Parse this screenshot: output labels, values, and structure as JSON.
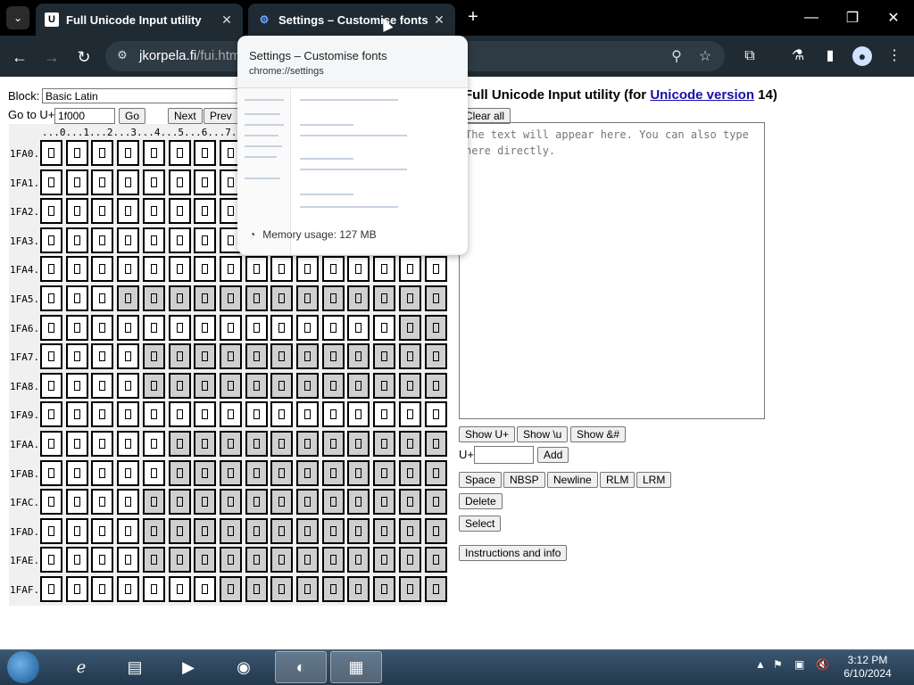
{
  "browser": {
    "tabs": [
      {
        "title": "Full Unicode Input utility",
        "favicon": "U",
        "active": true
      },
      {
        "title": "Settings – Customise fonts",
        "favicon": "⚙",
        "active": false
      }
    ],
    "url_host": "jkorpela.fi",
    "url_path": "/fui.html"
  },
  "preview": {
    "title": "Settings – Customise fonts",
    "url": "chrome://settings",
    "memory": "Memory usage: 127 MB"
  },
  "left": {
    "block_label": "Block:",
    "block_value": "Basic Latin",
    "goto_label": "Go to U+",
    "goto_value": "1f000",
    "go_button": "Go",
    "next_button": "Next",
    "prev_button": "Prev",
    "column_header": "...0...1...2...3...4...5...6...7...8...9...A...B...C...D...E...F",
    "row_labels": [
      "1FA0.",
      "1FA1.",
      "1FA2.",
      "1FA3.",
      "1FA4.",
      "1FA5.",
      "1FA6.",
      "1FA7.",
      "1FA8.",
      "1FA9.",
      "1FAA.",
      "1FAB.",
      "1FAC.",
      "1FAD.",
      "1FAE.",
      "1FAF."
    ],
    "unassigned_map": [
      "0000000000000000",
      "0000000000000000",
      "0000000000000000",
      "0000000000000000",
      "0000000000000000",
      "0001111111111111",
      "0000000000000011",
      "0000111111111111",
      "0000111111111111",
      "0000000000000000",
      "0000011111111111",
      "0000011111111111",
      "0000111111111111",
      "0000111111111111",
      "0000111111111111",
      "0000000111111111"
    ]
  },
  "right": {
    "title_prefix": "Full Unicode Input utility (for ",
    "title_link": "Unicode version",
    "title_suffix": " 14)",
    "clear_button": "Clear all",
    "textarea_placeholder": "The text will appear here. You can also type here directly.",
    "show_uplus": "Show U+",
    "show_u": "Show \\u",
    "show_amp": "Show &#",
    "uplus_label": "U+",
    "add_button": "Add",
    "space_button": "Space",
    "nbsp_button": "NBSP",
    "newline_button": "Newline",
    "rlm_button": "RLM",
    "lrm_button": "LRM",
    "delete_button": "Delete",
    "select_button": "Select",
    "instructions_button": "Instructions and info"
  },
  "taskbar": {
    "time": "3:12 PM",
    "date": "6/10/2024"
  }
}
